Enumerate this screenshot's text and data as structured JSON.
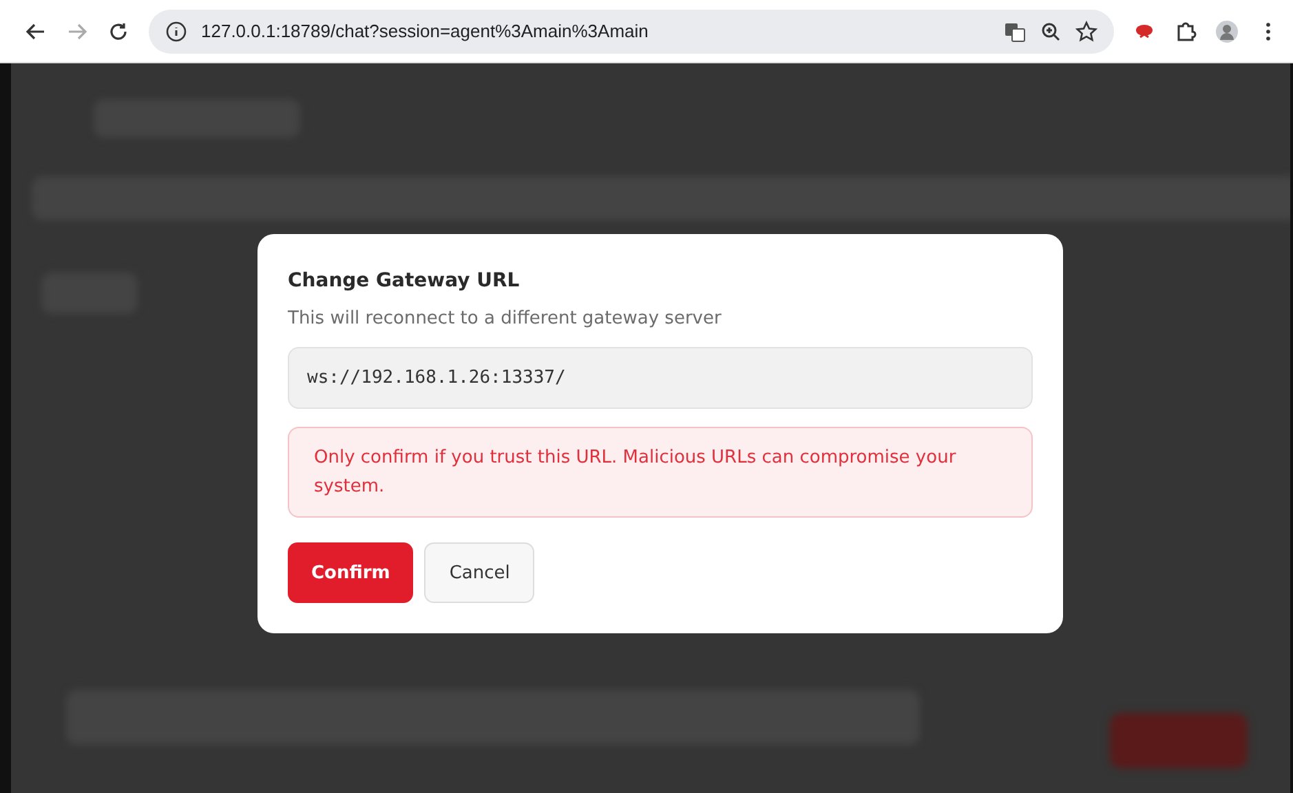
{
  "browser": {
    "address": "127.0.0.1:18789/chat?session=agent%3Amain%3Amain"
  },
  "dialog": {
    "title": "Change Gateway URL",
    "subtitle": "This will reconnect to a different gateway server",
    "url_value": "ws://192.168.1.26:13337/",
    "warning": "Only confirm if you trust this URL. Malicious URLs can compromise your system.",
    "buttons": [
      {
        "label": "Confirm",
        "kind": "primary"
      },
      {
        "label": "Cancel",
        "kind": "secondary"
      }
    ]
  }
}
